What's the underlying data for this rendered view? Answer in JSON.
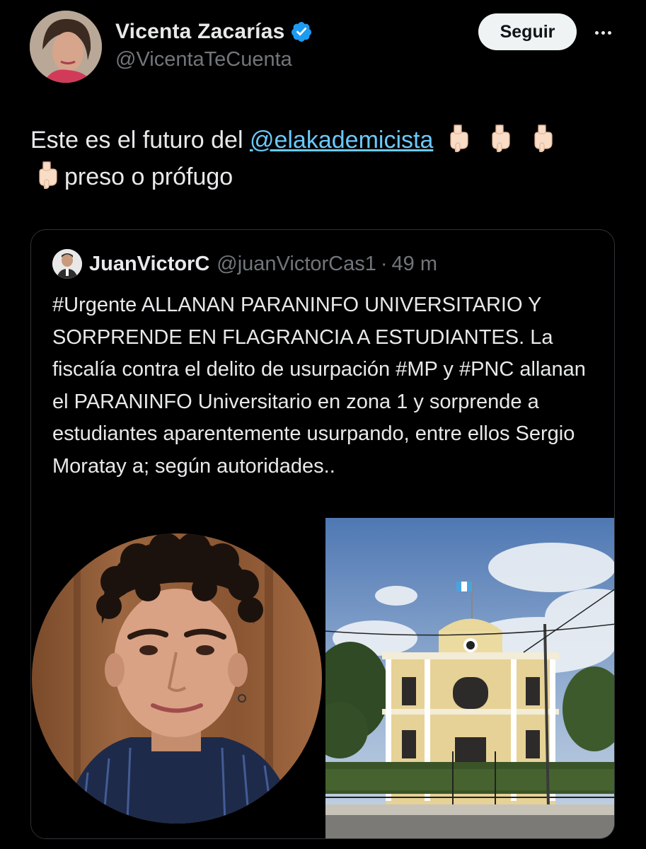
{
  "author": {
    "display_name": "Vicenta Zacarías",
    "handle": "@VicentaTeCuenta",
    "verified": true,
    "avatar_icon": "profile-photo"
  },
  "actions": {
    "follow_label": "Seguir",
    "more_icon": "more-horizontal-icon"
  },
  "tweet": {
    "text_before": "Este es el futuro del ",
    "mention": "@elakademicista",
    "text_after": "preso o prófugo",
    "emoji_icon": "backhand-index-pointing-down-icon",
    "emoji_count_line1": 3,
    "emoji_count_line2": 1
  },
  "quote": {
    "display_name": "JuanVictorC",
    "handle": "@juanVictorCas1",
    "separator": "·",
    "time": "49 m",
    "text": "#Urgente ALLANAN PARANINFO UNIVERSITARIO Y SORPRENDE EN FLAGRANCIA A ESTUDIANTES. La fiscalía contra el delito de usurpación #MP y #PNC allanan el PARANINFO Universitario en zona 1 y sorprende a estudiantes aparentemente usurpando, entre ellos Sergio Moratay a; según autoridades..",
    "media": [
      {
        "icon": "portrait-photo"
      },
      {
        "icon": "building-photo"
      }
    ]
  },
  "colors": {
    "background": "#000000",
    "text": "#e7e9ea",
    "secondary": "#71767b",
    "link": "#6bc9fb",
    "verified": "#1d9bf0",
    "border": "#2f3336",
    "button_bg": "#eff3f4"
  }
}
